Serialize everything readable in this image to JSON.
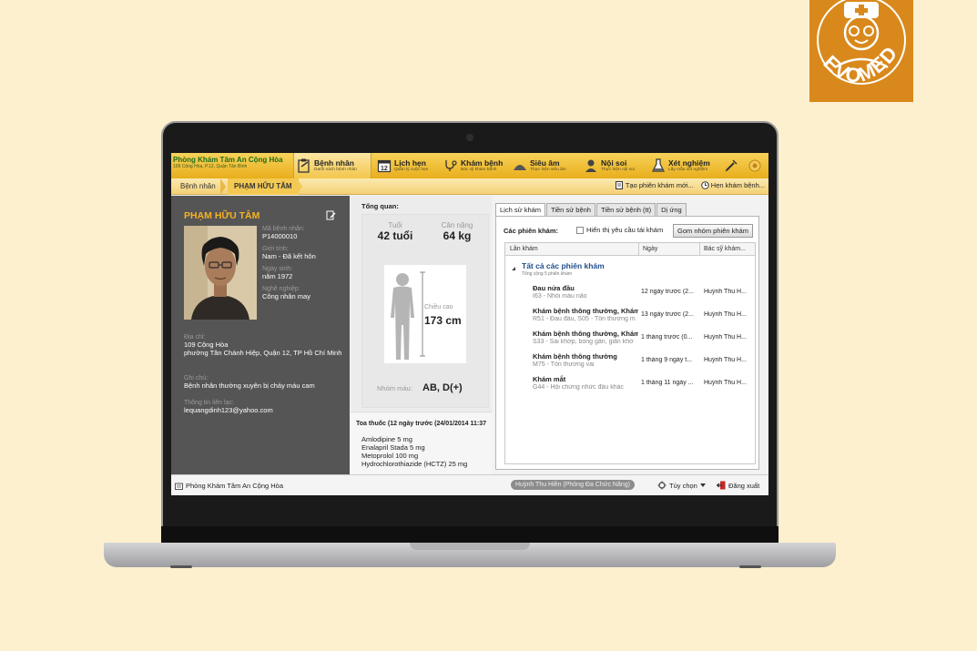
{
  "logo": {
    "text": "EVOMED"
  },
  "app": {
    "brand_name": "Phòng Khám Tâm An Cộng Hòa",
    "brand_address": "109 Cộng Hòa, P.12, Quận Tân Bình"
  },
  "nav": [
    {
      "title": "Bệnh nhân",
      "subtitle": "Danh sách bệnh nhân",
      "icon": "clipboard-icon",
      "active": true
    },
    {
      "title": "Lịch hẹn",
      "subtitle": "Quản lý cuộc hẹn",
      "icon": "calendar-icon",
      "active": false
    },
    {
      "title": "Khám bệnh",
      "subtitle": "Bác sỹ khám bệnh",
      "icon": "stethoscope-icon",
      "active": false
    },
    {
      "title": "Siêu âm",
      "subtitle": "Thực hiện siêu âm",
      "icon": "ultrasound-icon",
      "active": false
    },
    {
      "title": "Nội soi",
      "subtitle": "Thực hiện nội soi",
      "icon": "doctor-icon",
      "active": false
    },
    {
      "title": "Xét nghiệm",
      "subtitle": "Lấy mẫu xét nghiệm",
      "icon": "flask-icon",
      "active": false
    }
  ],
  "breadcrumb": {
    "root": "Bệnh nhân",
    "current": "PHẠM HỮU TÂM",
    "action_new_session": "Tạo phiên khám mới...",
    "action_appointment": "Hẹn khám bệnh..."
  },
  "patient": {
    "name": "PHẠM HỮU TÂM",
    "id_label": "Mã bệnh nhân:",
    "id": "P14000010",
    "gender_label": "Giới tính:",
    "gender": "Nam - Đã kết hôn",
    "dob_label": "Ngày sinh:",
    "dob": "năm 1972",
    "job_label": "Nghề nghiệp:",
    "job": "Công nhân may",
    "address_label": "Địa chỉ:",
    "address_line1": "109 Cộng Hòa",
    "address_line2": "phường Tân Chánh Hiệp, Quận 12, TP Hồ Chí Minh",
    "note_label": "Ghi chú:",
    "note": "Bệnh nhân thường xuyên bị chảy máu cam",
    "contact_label": "Thông tin liên lạc:",
    "contact": "lequangdinh123@yahoo.com"
  },
  "overview": {
    "title": "Tổng quan:",
    "age_label": "Tuổi",
    "age": "42 tuổi",
    "weight_label": "Cân nặng",
    "weight": "64 kg",
    "height_label": "Chiều cao",
    "height": "173 cm",
    "blood_label": "Nhóm máu:",
    "blood": "AB, D(+)"
  },
  "prescription": {
    "title": "Toa thuốc (12 ngày trước (24/01/2014 11:37",
    "items": [
      "Amlodipine 5 mg",
      "Enalapril Stada 5 mg",
      "Metoprolol 100 mg",
      "Hydrochlorothiazide (HCTZ) 25 mg"
    ]
  },
  "history": {
    "tabs": [
      "Lịch sử khám",
      "Tiền sử bệnh",
      "Tiền sử bệnh (tt)",
      "Dị ứng"
    ],
    "sessions_label": "Các phiên khám:",
    "checkbox_label": "Hiển thị yêu cầu tái khám",
    "group_button": "Gom nhóm phiên khám",
    "columns": [
      "Lần khám",
      "Ngày",
      "Bác sỹ khám..."
    ],
    "group_title": "Tất cả các phiên khám",
    "group_subtitle": "Tổng cộng 5 phiên khám",
    "rows": [
      {
        "title": "Đau nửa đầu",
        "detail": "I63 - Nhồi máu não",
        "date": "12 ngày trước (2...",
        "doctor": "Huỳnh Thu H..."
      },
      {
        "title": "Khám bệnh thông thường, Khám",
        "detail": "R51 - Đau đầu, S05 - Tổn thương m",
        "date": "13 ngày trước (2...",
        "doctor": "Huỳnh Thu H..."
      },
      {
        "title": "Khám bệnh thông thường, Khám",
        "detail": "S33 - Sai khớp, bong gân, giãn khớ",
        "date": "1 tháng trước (0...",
        "doctor": "Huỳnh Thu H..."
      },
      {
        "title": "Khám bệnh thông thường",
        "detail": "M75 - Tổn thương vai",
        "date": "1 tháng 9 ngày t...",
        "doctor": "Huỳnh Thu H..."
      },
      {
        "title": "Khám mắt",
        "detail": "G44 - Hội chứng nhức đầu khác",
        "date": "1 tháng 11 ngày ...",
        "doctor": "Huỳnh Thu H..."
      }
    ]
  },
  "statusbar": {
    "clinic": "Phòng Khám Tâm An Cộng Hòa",
    "user": "Huỳnh Thu Hiền (Phòng Đa Chức Năng)",
    "options": "Tùy chọn",
    "logout": "Đăng xuất"
  },
  "colors": {
    "accent": "#f0bb2e",
    "brand_green": "#1b6e1b",
    "panel": "#555555",
    "name": "#f5b323",
    "link": "#1f4e8c",
    "logo_bg": "#d9891c"
  }
}
